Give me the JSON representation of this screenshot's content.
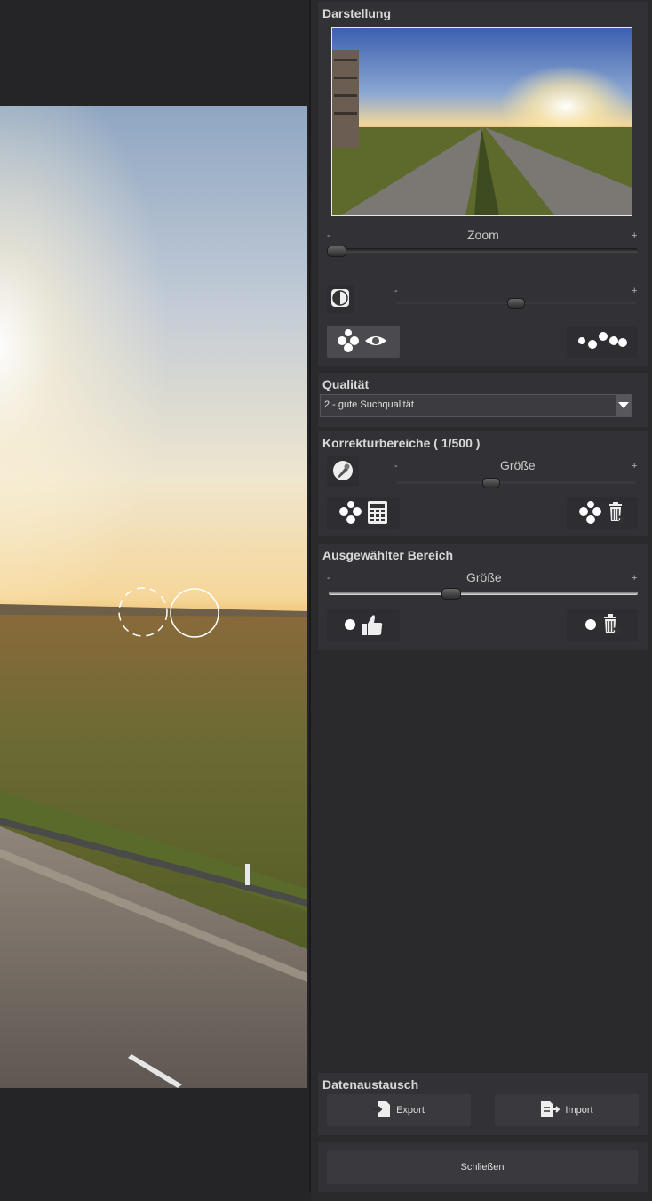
{
  "panel": {
    "darstellung": {
      "title": "Darstellung",
      "zoom_label": "Zoom",
      "zoom_minus": "-",
      "zoom_plus": "+",
      "contrast_minus": "-",
      "contrast_plus": "+",
      "zoom_level": 0.0,
      "contrast_level": 0.5
    },
    "qualitaet": {
      "title": "Qualität",
      "selected": "2 - gute Suchqualität"
    },
    "korrektur": {
      "title": "Korrekturbereiche  ( 1/500 )",
      "size_label": "Größe",
      "minus": "-",
      "plus": "+",
      "size_level": 0.4
    },
    "ausgewaehlt": {
      "title": "Ausgewählter Bereich",
      "size_label": "Größe",
      "minus": "-",
      "plus": "+",
      "size_level": 0.4
    },
    "datenaustausch": {
      "title": "Datenaustausch",
      "export_label": "Export",
      "import_label": "Import"
    },
    "close_label": "Schließen"
  },
  "icons": {
    "show_points": "dots-eye-icon",
    "points": "dots-icon",
    "brush": "brush-icon",
    "grid": "calculator-grid-icon",
    "delete": "trash-icon",
    "thumbs_up": "thumbs-up-icon",
    "export": "export-icon",
    "import": "import-icon",
    "contrast": "contrast-icon"
  }
}
